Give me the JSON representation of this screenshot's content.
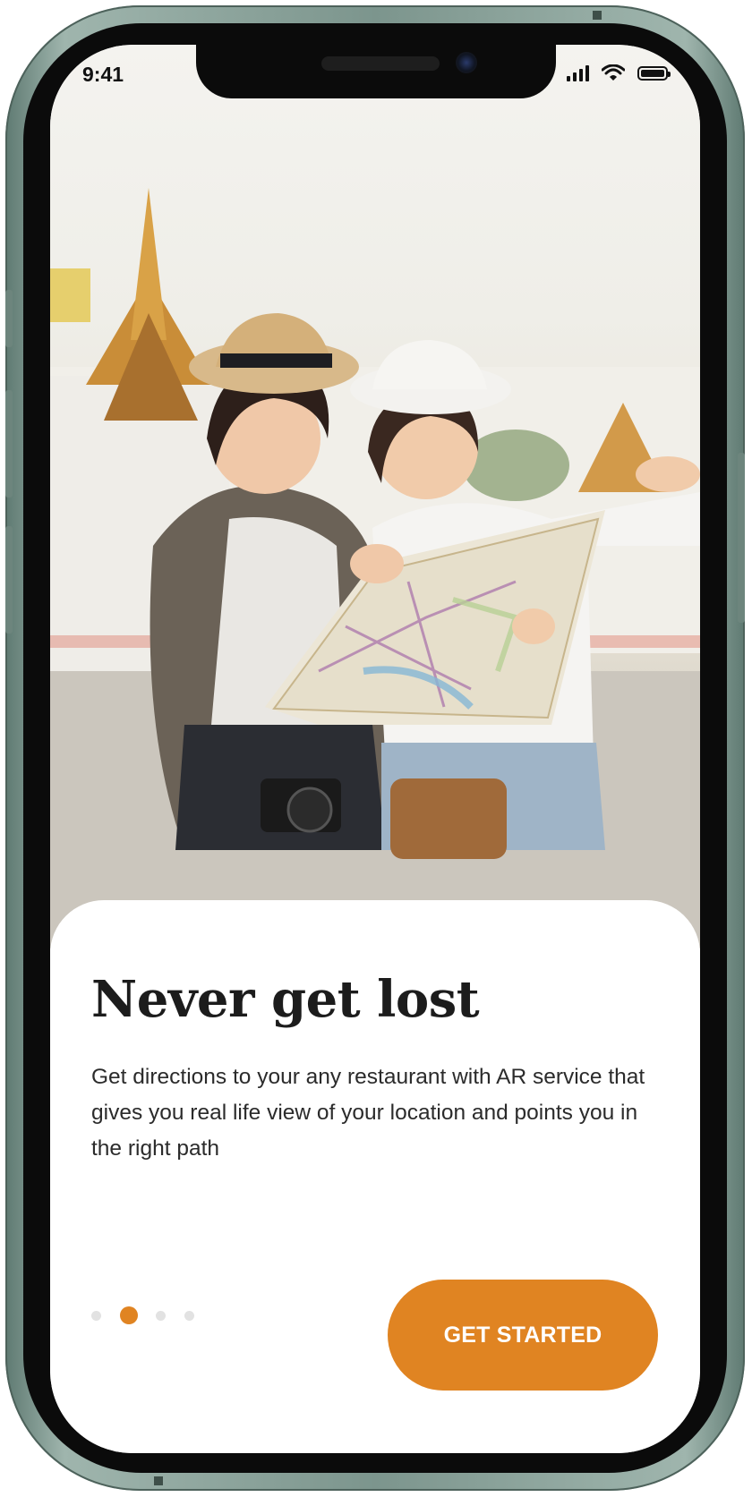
{
  "status_bar": {
    "time": "9:41",
    "icons": [
      "cellular-signal-icon",
      "wifi-icon",
      "battery-icon"
    ]
  },
  "hero": {
    "image_subject": "two travelers holding a map in front of a temple"
  },
  "onboarding": {
    "title": "Never get lost",
    "description": "Get directions to your any restaurant with AR service that gives you real life view of your location and points you in the right path",
    "pages_total": 4,
    "current_page": 2,
    "cta_label": "GET STARTED"
  },
  "colors": {
    "accent": "#e08422",
    "inactive_dot": "#e2e2e2",
    "text_dark": "#1c1c1c",
    "frame": "#7c958d"
  }
}
